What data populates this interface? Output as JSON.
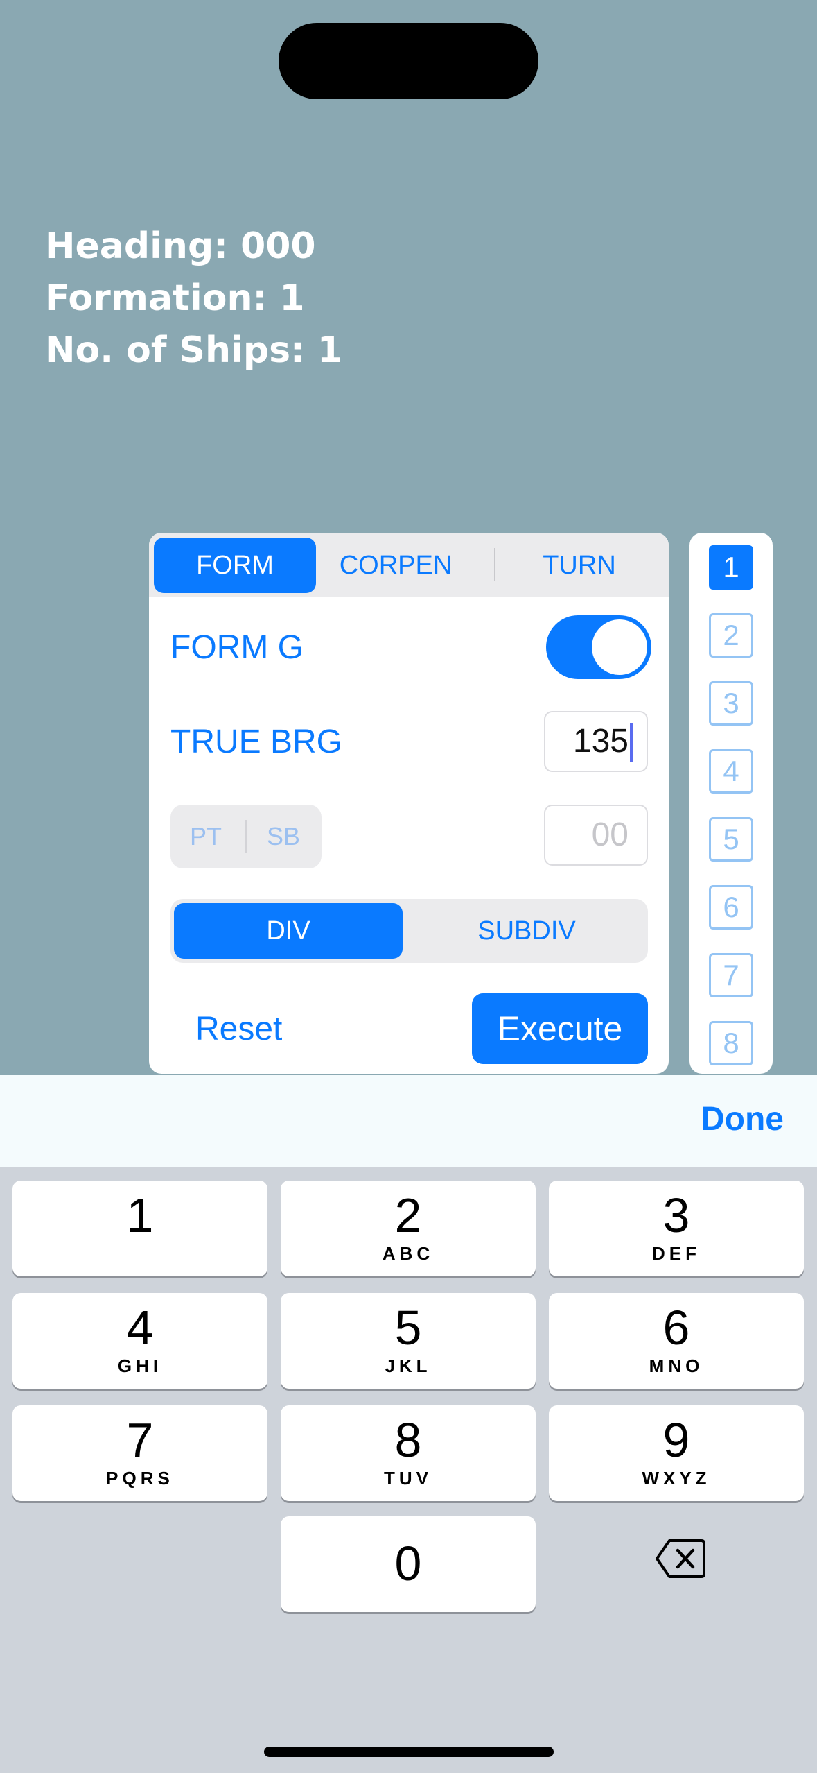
{
  "status": {
    "heading": "Heading: 000",
    "formation": "Formation: 1",
    "ships": "No. of Ships: 1"
  },
  "tabs": [
    "FORM",
    "CORPEN",
    "TURN"
  ],
  "form": {
    "form_g_label": "FORM G",
    "form_g_on": true,
    "true_brg_label": "TRUE BRG",
    "true_brg_value": "135",
    "pt_label": "PT",
    "sb_label": "SB",
    "offset_placeholder": "00",
    "div_label": "DIV",
    "subdiv_label": "SUBDIV",
    "reset_label": "Reset",
    "execute_label": "Execute"
  },
  "ship_numbers": [
    "1",
    "2",
    "3",
    "4",
    "5",
    "6",
    "7",
    "8"
  ],
  "keyboard": {
    "done_label": "Done",
    "keys": [
      {
        "digit": "1",
        "letters": ""
      },
      {
        "digit": "2",
        "letters": "ABC"
      },
      {
        "digit": "3",
        "letters": "DEF"
      },
      {
        "digit": "4",
        "letters": "GHI"
      },
      {
        "digit": "5",
        "letters": "JKL"
      },
      {
        "digit": "6",
        "letters": "MNO"
      },
      {
        "digit": "7",
        "letters": "PQRS"
      },
      {
        "digit": "8",
        "letters": "TUV"
      },
      {
        "digit": "9",
        "letters": "WXYZ"
      },
      {
        "digit": "0",
        "letters": ""
      }
    ],
    "backspace_icon": "delete-left-icon"
  },
  "colors": {
    "accent": "#0a7aff",
    "background": "#8aa8b2"
  }
}
